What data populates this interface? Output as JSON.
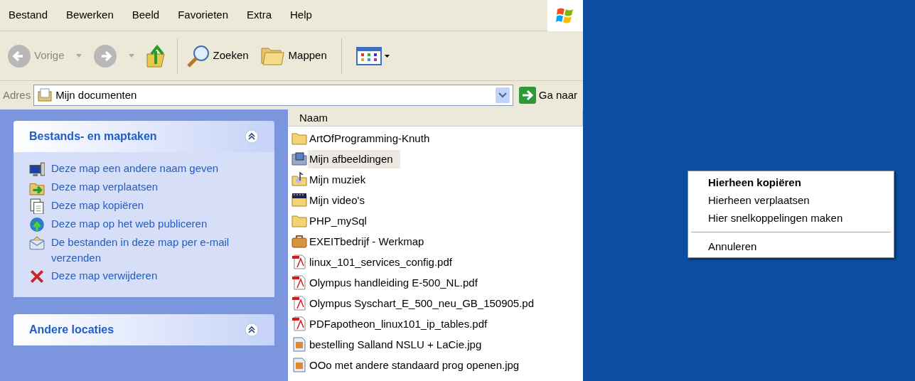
{
  "menu_bar": [
    "Bestand",
    "Bewerken",
    "Beeld",
    "Favorieten",
    "Extra",
    "Help"
  ],
  "toolbar": {
    "back": "Vorige",
    "search": "Zoeken",
    "folders": "Mappen"
  },
  "address_bar": {
    "label": "Adres",
    "value": "Mijn documenten",
    "go": "Ga naar"
  },
  "task_panes": [
    {
      "title": "Bestands- en maptaken",
      "expanded": true,
      "items": [
        {
          "kind": "rename",
          "label": "Deze map een andere naam geven"
        },
        {
          "kind": "move",
          "label": "Deze map verplaatsen"
        },
        {
          "kind": "copy",
          "label": "Deze map kopiëren"
        },
        {
          "kind": "publish",
          "label": "Deze map op het web publiceren"
        },
        {
          "kind": "email",
          "label": "De bestanden in deze map per e-mail verzenden"
        },
        {
          "kind": "delete",
          "label": "Deze map verwijderen"
        }
      ]
    },
    {
      "title": "Andere locaties",
      "expanded": true
    }
  ],
  "file_list": {
    "columns": [
      "Naam"
    ],
    "rows": [
      {
        "kind": "folder",
        "name": "ArtOfProgramming-Knuth",
        "selected": false
      },
      {
        "kind": "pictures",
        "name": "Mijn afbeeldingen",
        "selected": true
      },
      {
        "kind": "music",
        "name": "Mijn muziek",
        "selected": false
      },
      {
        "kind": "video",
        "name": "Mijn video's",
        "selected": false
      },
      {
        "kind": "folder",
        "name": "PHP_mySql",
        "selected": false
      },
      {
        "kind": "briefcase",
        "name": "EXEITbedrijf - Werkmap",
        "selected": false
      },
      {
        "kind": "pdf",
        "name": "linux_101_services_config.pdf",
        "selected": false
      },
      {
        "kind": "pdf",
        "name": "Olympus handleiding E-500_NL.pdf",
        "selected": false
      },
      {
        "kind": "pdf",
        "name": "Olympus Syschart_E_500_neu_GB_150905.pd",
        "selected": false
      },
      {
        "kind": "pdf",
        "name": "PDFapotheon_linux101_ip_tables.pdf",
        "selected": false
      },
      {
        "kind": "image",
        "name": "bestelling Salland NSLU + LaCie.jpg",
        "selected": false
      },
      {
        "kind": "image",
        "name": "OOo met andere standaard prog openen.jpg",
        "selected": false
      }
    ]
  },
  "context_menu": [
    {
      "kind": "item",
      "label": "Hierheen kopiëren",
      "default": true
    },
    {
      "kind": "item",
      "label": "Hierheen verplaatsen",
      "default": false
    },
    {
      "kind": "item",
      "label": "Hier snelkoppelingen maken",
      "default": false
    },
    {
      "kind": "separator"
    },
    {
      "kind": "item",
      "label": "Annuleren",
      "default": false
    }
  ]
}
